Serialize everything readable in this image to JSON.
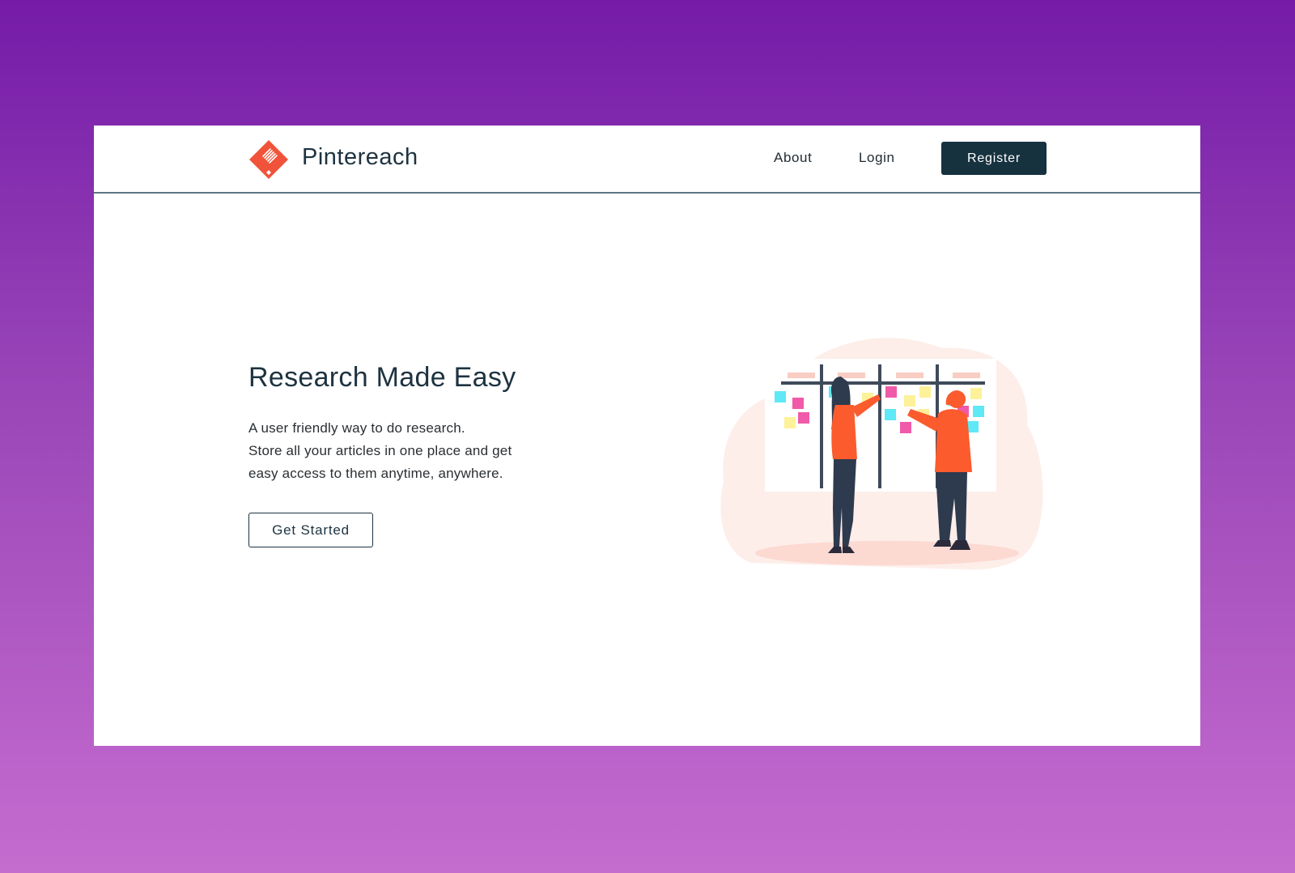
{
  "brand": {
    "name": "Pintereach",
    "logo_icon": "diamond-book-icon",
    "logo_color": "#f0533a"
  },
  "nav": {
    "about_label": "About",
    "login_label": "Login",
    "register_label": "Register"
  },
  "hero": {
    "title": "Research Made Easy",
    "line1": "A user friendly way to do research.",
    "line2": "Store all your articles in one place and get",
    "line3": "easy access to them anytime, anywhere.",
    "cta_label": "Get Started",
    "illustration": "people-at-sticky-note-board-illustration"
  },
  "colors": {
    "primary_dark": "#17323f",
    "accent": "#f0533a",
    "background_gradient_top": "#751ba8",
    "background_gradient_bottom": "#c56ccf"
  }
}
